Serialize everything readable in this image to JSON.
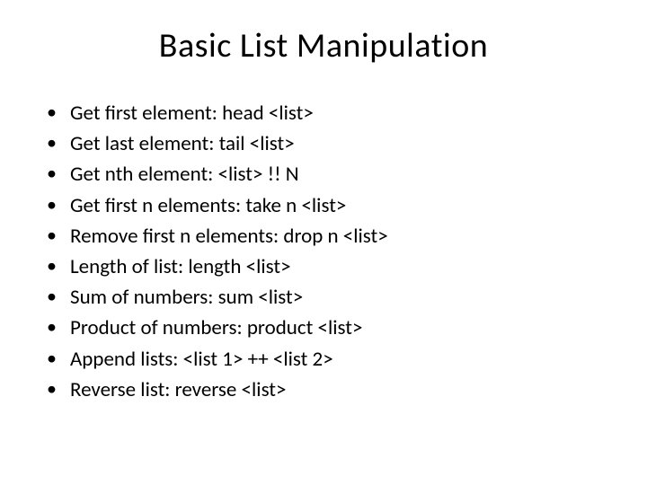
{
  "title": "Basic List Manipulation",
  "items": [
    "Get first element: head <list>",
    "Get last element: tail <list>",
    "Get nth element: <list> !! N",
    "Get first n elements: take n <list>",
    "Remove first n elements: drop n <list>",
    "Length of list: length <list>",
    "Sum of numbers: sum <list>",
    "Product of numbers: product <list>",
    "Append lists: <list 1> ++ <list 2>",
    "Reverse list: reverse <list>"
  ]
}
